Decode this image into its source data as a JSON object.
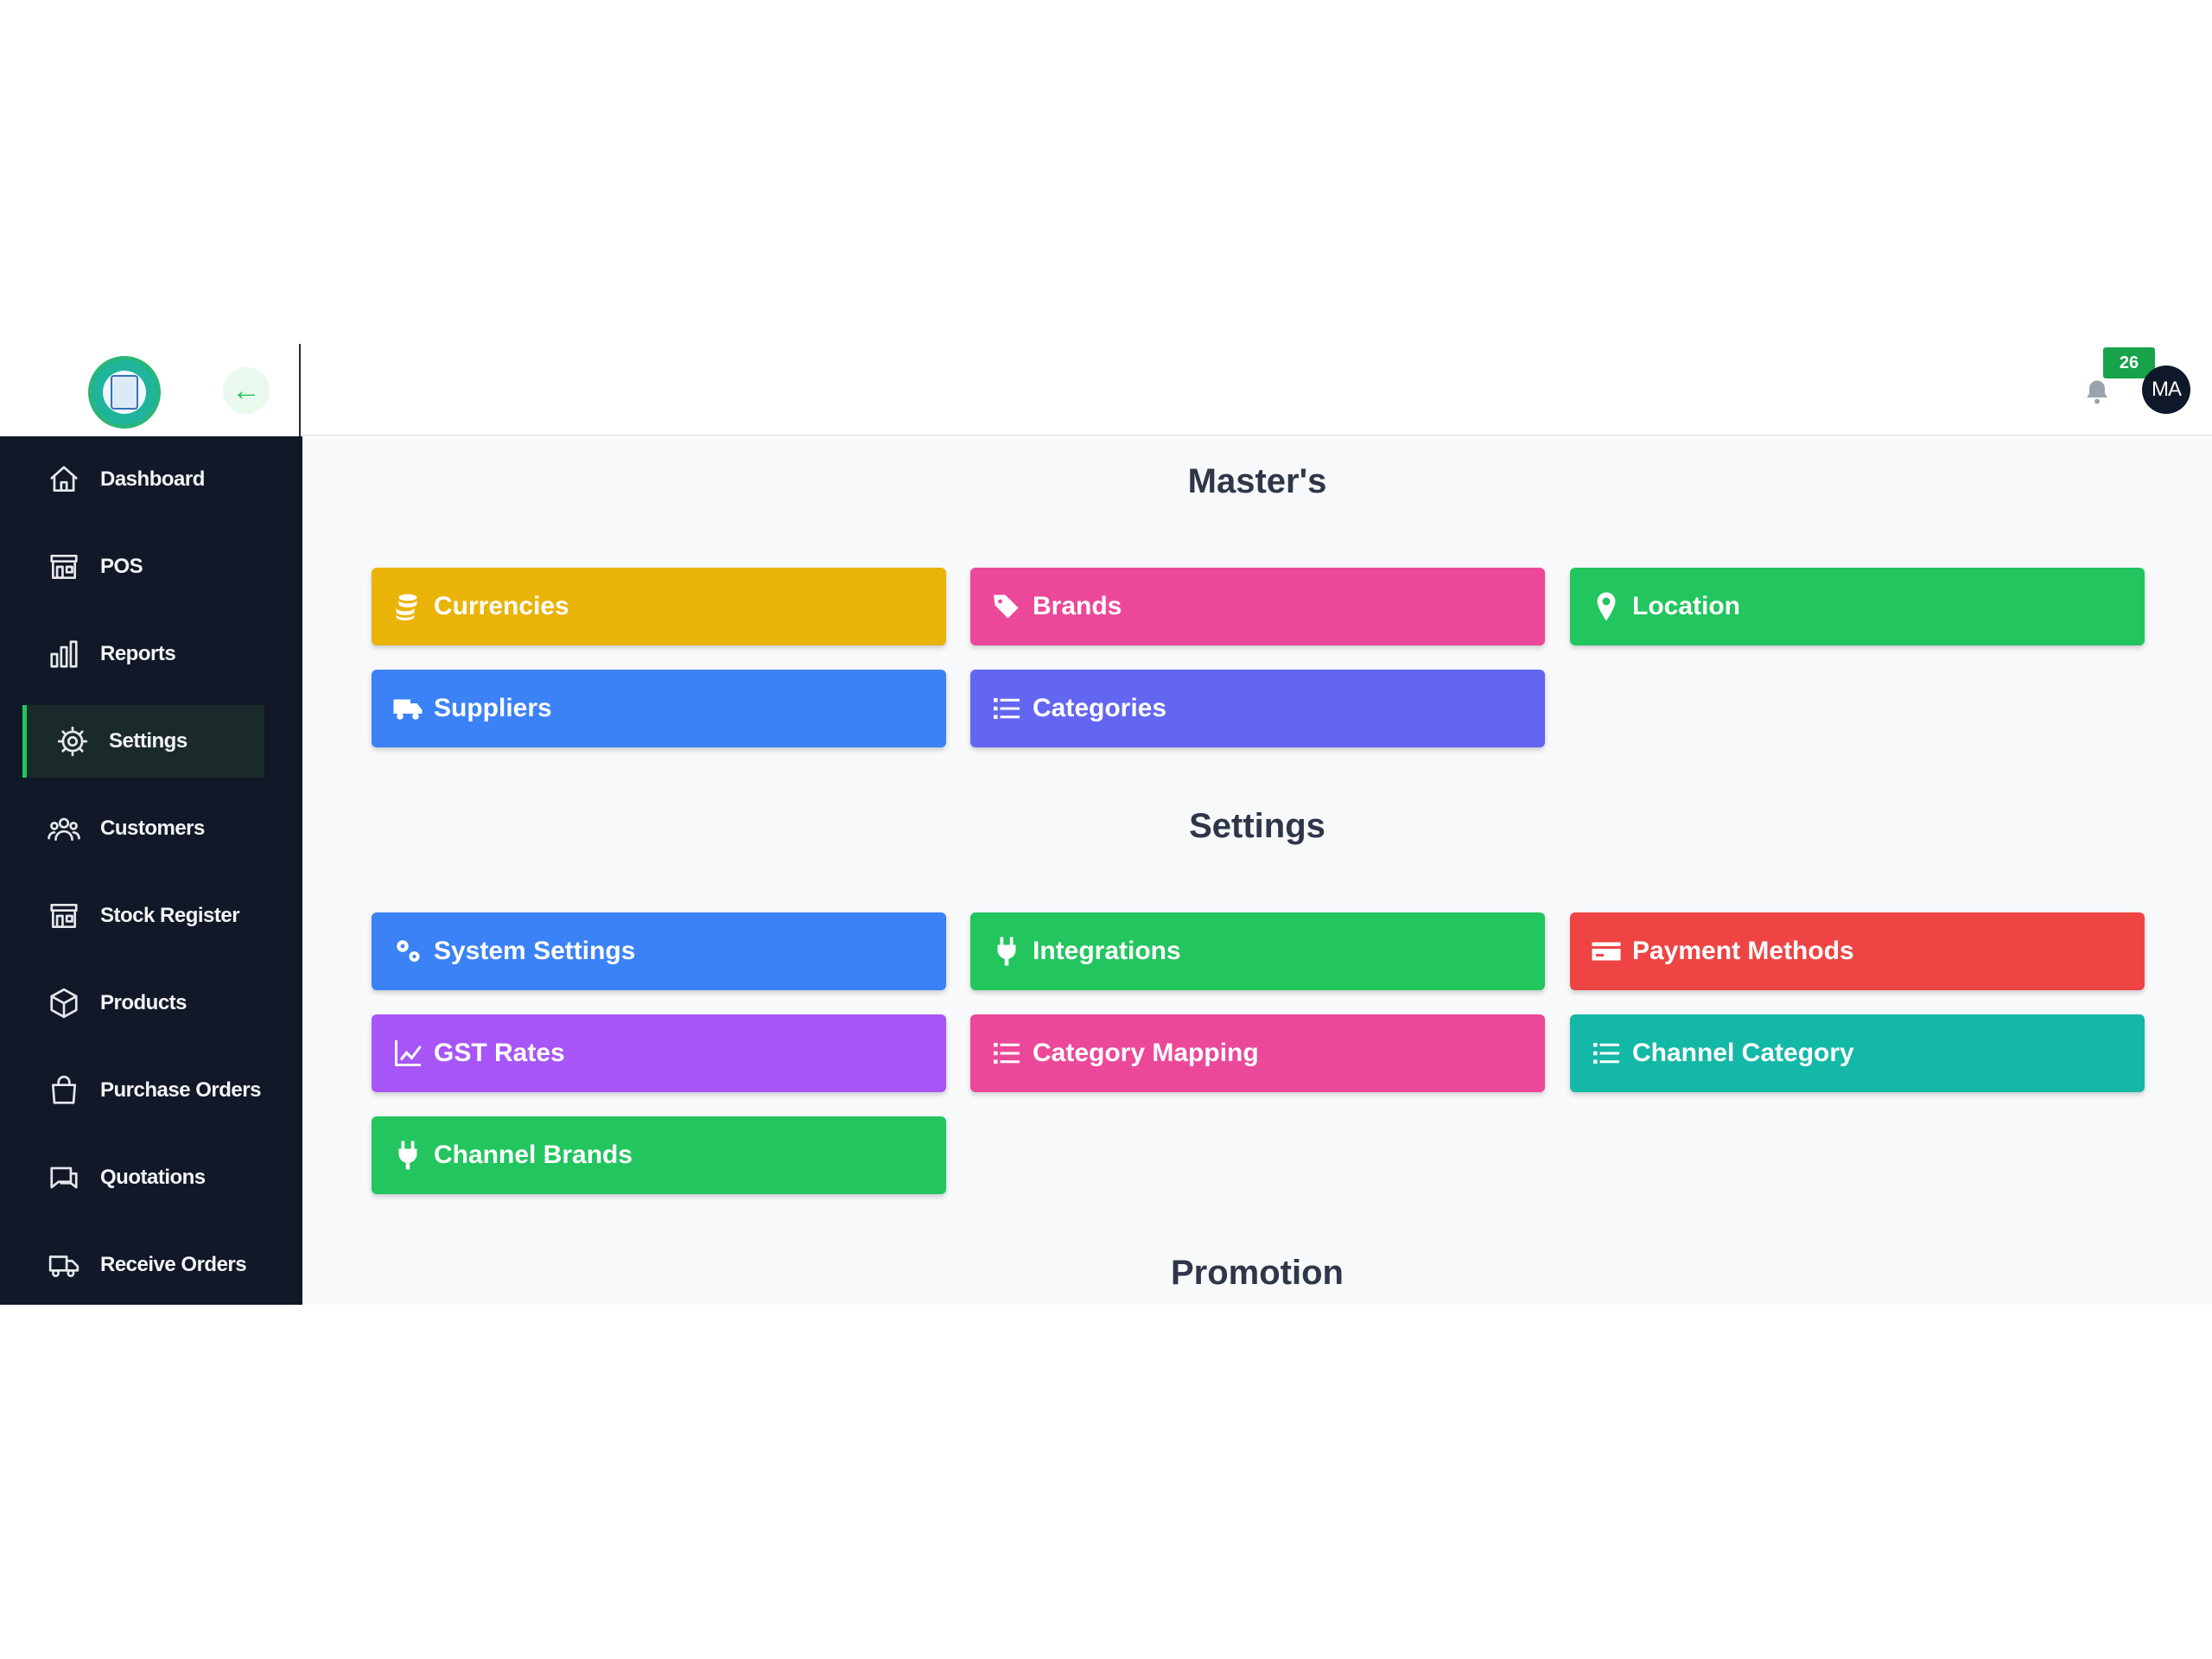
{
  "header": {
    "back_icon": "arrow-left-icon",
    "notification_count": "26",
    "avatar_initials": "MA"
  },
  "sidebar": {
    "items": [
      {
        "label": "Dashboard",
        "icon": "home-icon"
      },
      {
        "label": "POS",
        "icon": "store-icon"
      },
      {
        "label": "Reports",
        "icon": "bar-chart-icon"
      },
      {
        "label": "Settings",
        "icon": "gear-icon",
        "active": true
      },
      {
        "label": "Customers",
        "icon": "users-icon"
      },
      {
        "label": "Stock Register",
        "icon": "store-icon"
      },
      {
        "label": "Products",
        "icon": "box-icon"
      },
      {
        "label": "Purchase Orders",
        "icon": "shopping-bag-icon"
      },
      {
        "label": "Quotations",
        "icon": "chat-icon"
      },
      {
        "label": "Receive Orders",
        "icon": "truck-icon"
      }
    ]
  },
  "sections": {
    "masters": {
      "title": "Master's",
      "tiles": [
        {
          "label": "Currencies",
          "icon": "coins-icon",
          "color": "#eab308"
        },
        {
          "label": "Brands",
          "icon": "tags-icon",
          "color": "#ec4899"
        },
        {
          "label": "Location",
          "icon": "map-pin-icon",
          "color": "#22c55e"
        },
        {
          "label": "Suppliers",
          "icon": "truck-icon",
          "color": "#3b82f6"
        },
        {
          "label": "Categories",
          "icon": "list-icon",
          "color": "#6366f1"
        }
      ]
    },
    "settings": {
      "title": "Settings",
      "tiles": [
        {
          "label": "System Settings",
          "icon": "gears-icon",
          "color": "#3b82f6"
        },
        {
          "label": "Integrations",
          "icon": "plug-icon",
          "color": "#22c55e"
        },
        {
          "label": "Payment Methods",
          "icon": "credit-card-icon",
          "color": "#ef4444"
        },
        {
          "label": "GST Rates",
          "icon": "line-chart-icon",
          "color": "#a855f7"
        },
        {
          "label": "Category Mapping",
          "icon": "list-icon",
          "color": "#ec4899"
        },
        {
          "label": "Channel Category",
          "icon": "list-icon",
          "color": "#14b8a6"
        },
        {
          "label": "Channel Brands",
          "icon": "plug-icon",
          "color": "#22c55e"
        }
      ]
    },
    "promotion": {
      "title": "Promotion"
    }
  }
}
